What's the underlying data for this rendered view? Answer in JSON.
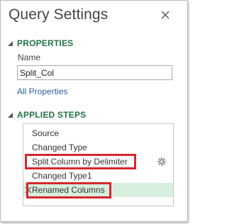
{
  "panel": {
    "title": "Query Settings"
  },
  "properties": {
    "header": "PROPERTIES",
    "name_label": "Name",
    "name_value": "Split_Col",
    "all_properties_link": "All Properties"
  },
  "applied_steps": {
    "header": "APPLIED STEPS",
    "steps": [
      {
        "label": "Source"
      },
      {
        "label": "Changed Type"
      },
      {
        "label": "Split Column by Delimiter"
      },
      {
        "label": "Changed Type1"
      },
      {
        "label": "Renamed Columns"
      }
    ],
    "selected_step": "Renamed Columns",
    "highlighted_steps": [
      "Split Column by Delimiter",
      "Renamed Columns"
    ]
  },
  "icons": {
    "close": "close-icon",
    "collapse_caret": "caret-down-icon",
    "step_settings": "gear-icon",
    "delete_step": "x-icon"
  },
  "colors": {
    "section_header": "#217346",
    "link": "#2a5fa5",
    "selected_row": "#d7efdf",
    "highlight_border": "#d8262c"
  }
}
